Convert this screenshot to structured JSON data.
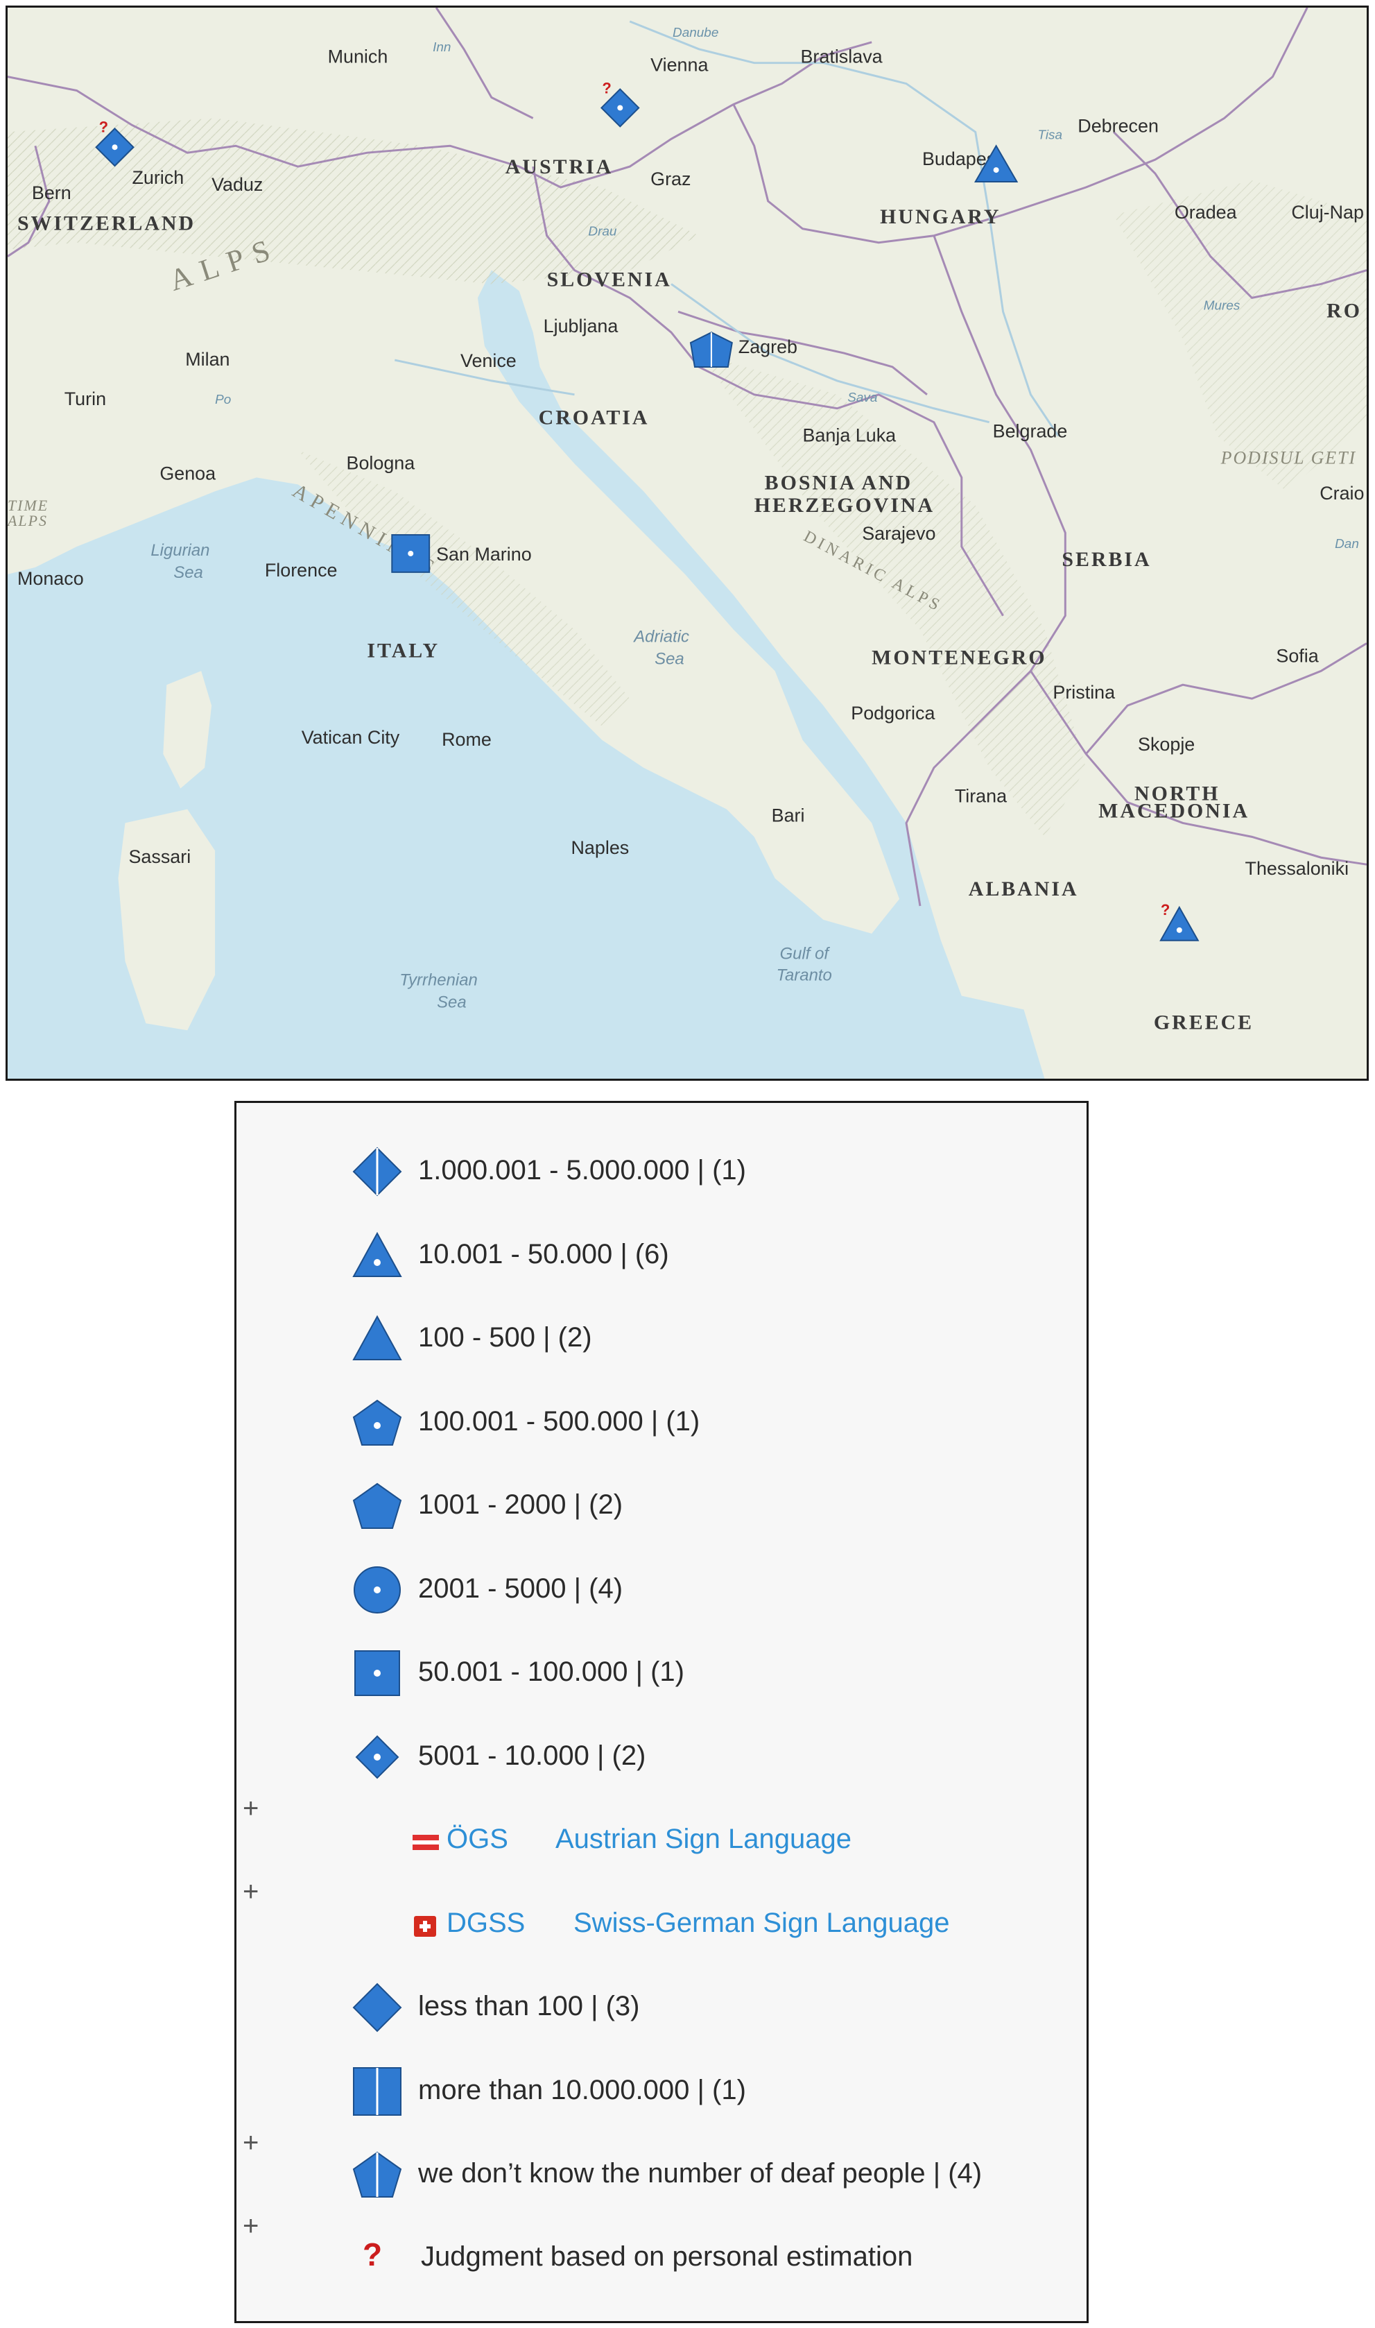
{
  "map": {
    "cities": [
      {
        "name": "Munich"
      },
      {
        "name": "Vienna"
      },
      {
        "name": "Bratislava"
      },
      {
        "name": "Bern"
      },
      {
        "name": "Zurich"
      },
      {
        "name": "Vaduz"
      },
      {
        "name": "Graz"
      },
      {
        "name": "Budapest"
      },
      {
        "name": "Debrecen"
      },
      {
        "name": "Oradea"
      },
      {
        "name": "Cluj-Nap"
      },
      {
        "name": "Ljubljana"
      },
      {
        "name": "Zagreb"
      },
      {
        "name": "Milan"
      },
      {
        "name": "Turin"
      },
      {
        "name": "Venice"
      },
      {
        "name": "Genoa"
      },
      {
        "name": "Bologna"
      },
      {
        "name": "Monaco"
      },
      {
        "name": "Florence"
      },
      {
        "name": "San Marino"
      },
      {
        "name": "Banja Luka"
      },
      {
        "name": "Belgrade"
      },
      {
        "name": "Sarajevo"
      },
      {
        "name": "Craio"
      },
      {
        "name": "Sofia"
      },
      {
        "name": "Pristina"
      },
      {
        "name": "Podgorica"
      },
      {
        "name": "Skopje"
      },
      {
        "name": "Vatican City"
      },
      {
        "name": "Rome"
      },
      {
        "name": "Tirana"
      },
      {
        "name": "Bari"
      },
      {
        "name": "Naples"
      },
      {
        "name": "Sassari"
      },
      {
        "name": "Thessaloniki"
      }
    ],
    "countries": [
      {
        "name": "AUSTRIA"
      },
      {
        "name": "HUNGARY"
      },
      {
        "name": "SWITZERLAND"
      },
      {
        "name": "SLOVENIA"
      },
      {
        "name": "CROATIA"
      },
      {
        "name": "BOSNIA AND"
      },
      {
        "name": "HERZEGOVINA"
      },
      {
        "name": "SERBIA"
      },
      {
        "name": "ITALY"
      },
      {
        "name": "MONTENEGRO"
      },
      {
        "name": "NORTH"
      },
      {
        "name": "MACEDONIA"
      },
      {
        "name": "ALBANIA"
      },
      {
        "name": "GREECE"
      },
      {
        "name": "RO"
      }
    ],
    "water_labels": [
      {
        "name": "Ligurian"
      },
      {
        "name": "Sea"
      },
      {
        "name": "Adriatic"
      },
      {
        "name": "Sea"
      },
      {
        "name": "Tyrrhenian"
      },
      {
        "name": "Sea"
      },
      {
        "name": "Gulf of"
      },
      {
        "name": "Taranto"
      }
    ],
    "river_labels": [
      {
        "name": "Danube"
      },
      {
        "name": "Inn"
      },
      {
        "name": "Drau"
      },
      {
        "name": "Sava"
      },
      {
        "name": "Tisa"
      },
      {
        "name": "Mures"
      },
      {
        "name": "Po"
      },
      {
        "name": "Dan"
      }
    ],
    "mountain_labels": [
      {
        "name": "ALPS"
      },
      {
        "name": "APENNINES"
      },
      {
        "name": "DINARIC ALPS"
      },
      {
        "name": "PODISUL GETI"
      },
      {
        "name": "ALPS"
      },
      {
        "name": "TIME"
      }
    ],
    "markers": [
      {
        "place": "Zurich",
        "symbol": "diamond-dot",
        "estimated": true
      },
      {
        "place": "Vienna",
        "symbol": "diamond-dot",
        "estimated": true
      },
      {
        "place": "Budapest",
        "symbol": "triangle-dot",
        "estimated": false
      },
      {
        "place": "Zagreb",
        "symbol": "pentagon-split",
        "estimated": false
      },
      {
        "place": "San Marino",
        "symbol": "square-dot",
        "estimated": false
      },
      {
        "place": "Greece",
        "symbol": "triangle-dot",
        "estimated": true
      }
    ],
    "colors": {
      "sea": "#c9e4ef",
      "land": "#eef0e4",
      "border": "#a58ab5",
      "marker": "#2f7ad1"
    }
  },
  "legend": {
    "items": [
      {
        "symbol": "diamond-split",
        "label": "1.000.001 - 5.000.000 | (1)"
      },
      {
        "symbol": "triangle-dot",
        "label": "10.001 - 50.000 | (6)"
      },
      {
        "symbol": "triangle",
        "label": "100 - 500 | (2)"
      },
      {
        "symbol": "pentagon-dot",
        "label": "100.001 - 500.000 | (1)"
      },
      {
        "symbol": "pentagon",
        "label": "1001 - 2000 | (2)"
      },
      {
        "symbol": "circle-dot",
        "label": "2001 - 5000 | (4)"
      },
      {
        "symbol": "square-dot",
        "label": "50.001 - 100.000 | (1)"
      },
      {
        "symbol": "diamond-dot",
        "label": "5001 - 10.000 | (2)"
      }
    ],
    "sub_items": [
      {
        "flag": "austria-flag-icon",
        "code": "ÖGS",
        "name": "Austrian Sign Language"
      },
      {
        "flag": "swiss-flag-icon",
        "code": "DGSS",
        "name": "Swiss-German Sign Language"
      }
    ],
    "items_after": [
      {
        "symbol": "diamond",
        "label": "less than 100 | (3)"
      },
      {
        "symbol": "square-split",
        "label": "more than 10.000.000 | (1)"
      },
      {
        "symbol": "pentagon-split",
        "label": "we don’t know the number of deaf people | (4)"
      }
    ],
    "estimation_note": {
      "icon": "question-icon",
      "mark": "?",
      "label": "Judgment based on personal estimation"
    },
    "plus_mark": "+"
  }
}
